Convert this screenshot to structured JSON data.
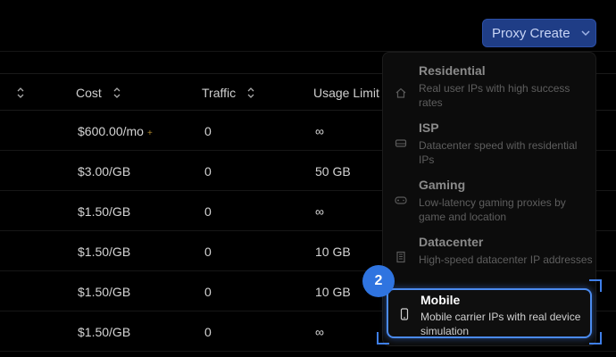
{
  "header": {
    "create_button_label": "Proxy Create"
  },
  "table": {
    "columns": [
      {
        "label": "Cost"
      },
      {
        "label": "Traffic"
      },
      {
        "label": "Usage Limit"
      }
    ],
    "rows": [
      {
        "cost": "$600.00/mo",
        "cost_mark": "+",
        "traffic": "0",
        "limit": "∞"
      },
      {
        "cost": "$3.00/GB",
        "traffic": "0",
        "limit": "50 GB"
      },
      {
        "cost": "$1.50/GB",
        "traffic": "0",
        "limit": "∞"
      },
      {
        "cost": "$1.50/GB",
        "traffic": "0",
        "limit": "10 GB"
      },
      {
        "cost": "$1.50/GB",
        "traffic": "0",
        "limit": "10 GB"
      },
      {
        "cost": "$1.50/GB",
        "traffic": "0",
        "limit": "∞"
      }
    ]
  },
  "menu": {
    "items": [
      {
        "title": "Residential",
        "desc": "Real user IPs with high success rates",
        "icon": "home-icon"
      },
      {
        "title": "ISP",
        "desc": "Datacenter speed with residential IPs",
        "icon": "hard-drive-icon"
      },
      {
        "title": "Gaming",
        "desc": "Low-latency gaming proxies by game and location",
        "icon": "gamepad-icon"
      },
      {
        "title": "Datacenter",
        "desc": "High-speed datacenter IP addresses",
        "icon": "building-icon"
      },
      {
        "title": "Mobile",
        "desc": "Mobile carrier IPs with real device simulation",
        "icon": "smartphone-icon",
        "selected": true
      }
    ]
  },
  "step_badge": "2",
  "colors": {
    "accent": "#2f74e0",
    "button_bg": "#1f3d86",
    "highlight": "#4b8bf0"
  }
}
